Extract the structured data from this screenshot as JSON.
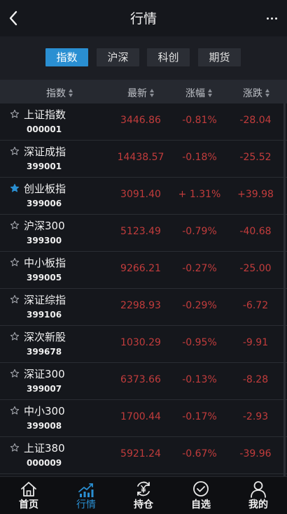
{
  "header": {
    "title": "行情"
  },
  "tabs": [
    {
      "label": "指数",
      "active": true
    },
    {
      "label": "沪深",
      "active": false
    },
    {
      "label": "科创",
      "active": false
    },
    {
      "label": "期货",
      "active": false
    }
  ],
  "columns": {
    "name": "指数",
    "price": "最新",
    "pct": "涨幅",
    "change": "涨跌"
  },
  "rows": [
    {
      "name": "上证指数",
      "code": "000001",
      "price": "3446.86",
      "pct": "-0.81%",
      "change": "-28.04",
      "starred": false
    },
    {
      "name": "深证成指",
      "code": "399001",
      "price": "14438.57",
      "pct": "-0.18%",
      "change": "-25.52",
      "starred": false
    },
    {
      "name": "创业板指",
      "code": "399006",
      "price": "3091.40",
      "pct": "+ 1.31%",
      "change": "+39.98",
      "starred": true
    },
    {
      "name": "沪深300",
      "code": "399300",
      "price": "5123.49",
      "pct": "-0.79%",
      "change": "-40.68",
      "starred": false
    },
    {
      "name": "中小板指",
      "code": "399005",
      "price": "9266.21",
      "pct": "-0.27%",
      "change": "-25.00",
      "starred": false
    },
    {
      "name": "深证综指",
      "code": "399106",
      "price": "2298.93",
      "pct": "-0.29%",
      "change": "-6.72",
      "starred": false
    },
    {
      "name": "深次新股",
      "code": "399678",
      "price": "1030.29",
      "pct": "-0.95%",
      "change": "-9.91",
      "starred": false
    },
    {
      "name": "深证300",
      "code": "399007",
      "price": "6373.66",
      "pct": "-0.13%",
      "change": "-8.28",
      "starred": false
    },
    {
      "name": "中小300",
      "code": "399008",
      "price": "1700.44",
      "pct": "-0.17%",
      "change": "-2.93",
      "starred": false
    },
    {
      "name": "上证380",
      "code": "000009",
      "price": "5921.24",
      "pct": "-0.67%",
      "change": "-39.96",
      "starred": false
    }
  ],
  "bottom_nav": [
    {
      "label": "首页",
      "icon": "home-icon",
      "active": false
    },
    {
      "label": "行情",
      "icon": "market-chart-icon",
      "active": true
    },
    {
      "label": "持仓",
      "icon": "yen-refresh-icon",
      "active": false
    },
    {
      "label": "自选",
      "icon": "check-circle-icon",
      "active": false
    },
    {
      "label": "我的",
      "icon": "user-icon",
      "active": false
    }
  ],
  "colors": {
    "accent": "#2a8fd2",
    "price_red": "#c23c3c",
    "background": "#15171c"
  }
}
